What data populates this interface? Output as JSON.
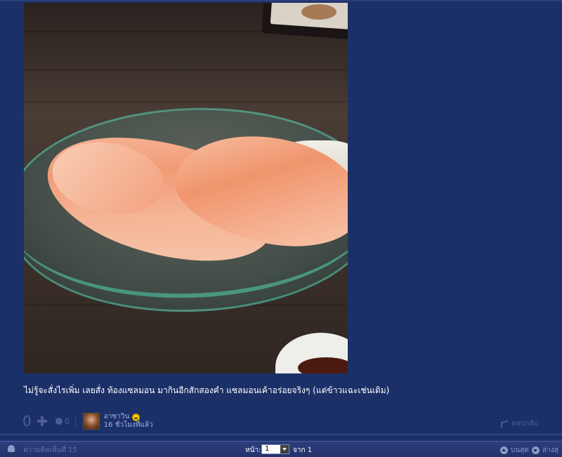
{
  "post": {
    "text": "ไม่รู้จะสั่งไรเพิ่ม เลยสั่ง ท้องแซลมอน มากินอีกสักสองคำ แซลมอนเค้าอร่อยจริงๆ (แต่ข้าวแฉะเช่นเดิม)",
    "score": "0",
    "emotion_count": "0",
    "user": {
      "name": "อาซาวิน",
      "time": "16 ชั่วโมงที่แล้ว"
    },
    "reply_label": "ตอบกลับ"
  },
  "bottom_bar": {
    "comment_label": "ความคิดเห็นที่ 15",
    "page_label": "หน้า:",
    "page_value": "1",
    "of_label": "จาก 1",
    "top_label": "บนสุด",
    "bottom_label": "ล่างสุ"
  },
  "icons": {
    "plus": "plus-icon",
    "emotion": "emotion-icon",
    "smiley": "smiley-icon",
    "reply": "reply-icon",
    "user": "user-icon",
    "up": "arrow-up-icon",
    "down": "arrow-down-icon"
  },
  "colors": {
    "background": "#1c3068",
    "muted": "#4c5f92",
    "link": "#9fb3e0"
  }
}
